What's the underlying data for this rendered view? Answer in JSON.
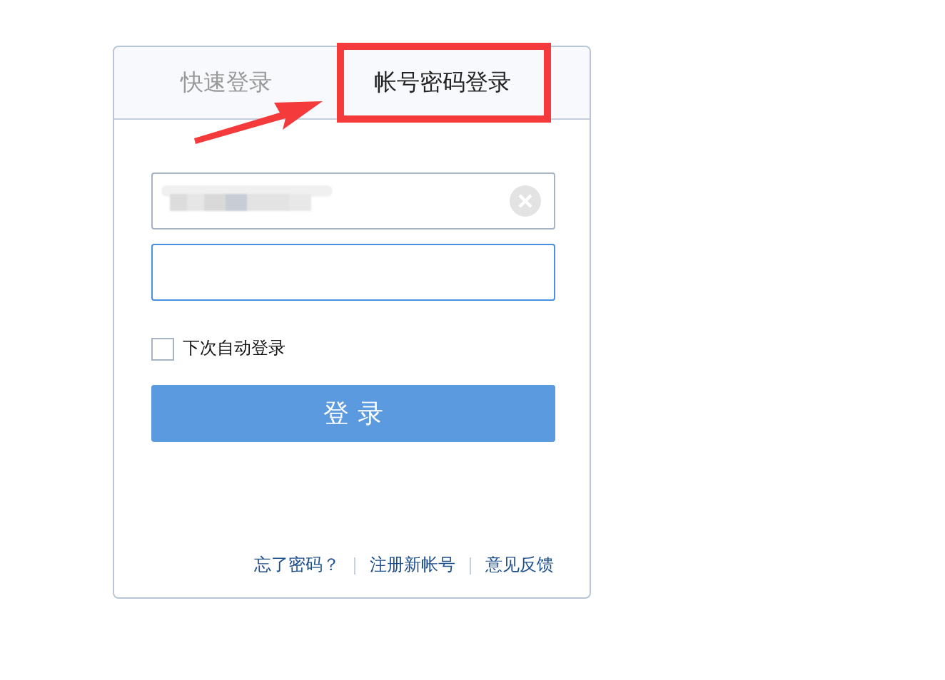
{
  "tabs": [
    {
      "label": "快速登录",
      "selected": false
    },
    {
      "label": "帐号密码登录",
      "selected": true
    }
  ],
  "username_field": {
    "masked": true,
    "clearable": true
  },
  "password_field": {
    "focused": true
  },
  "remember_login": {
    "label": "下次自动登录",
    "checked": false
  },
  "login_button": {
    "label": "登 录"
  },
  "links": [
    "忘了密码？",
    "注册新帐号",
    "意见反馈"
  ],
  "annotation_box": true,
  "annotation_arrow": true
}
